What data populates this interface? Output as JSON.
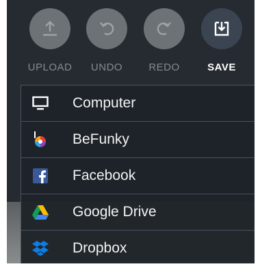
{
  "toolbar": {
    "upload_label": "UPLOAD",
    "undo_label": "UNDO",
    "redo_label": "REDO",
    "save_label": "SAVE"
  },
  "save_menu": {
    "items": [
      {
        "label": "Computer",
        "icon": "monitor-icon"
      },
      {
        "label": "BeFunky",
        "icon": "befunky-logo-icon"
      },
      {
        "label": "Facebook",
        "icon": "facebook-icon"
      },
      {
        "label": "Google Drive",
        "icon": "google-drive-icon"
      },
      {
        "label": "Dropbox",
        "icon": "dropbox-icon"
      }
    ]
  },
  "colors": {
    "panel_background": "#262b31",
    "disabled_button": "#6d7276",
    "active_button": "#3b4552",
    "facebook_blue": "#3b5998",
    "dropbox_blue": "#0d7de4"
  }
}
